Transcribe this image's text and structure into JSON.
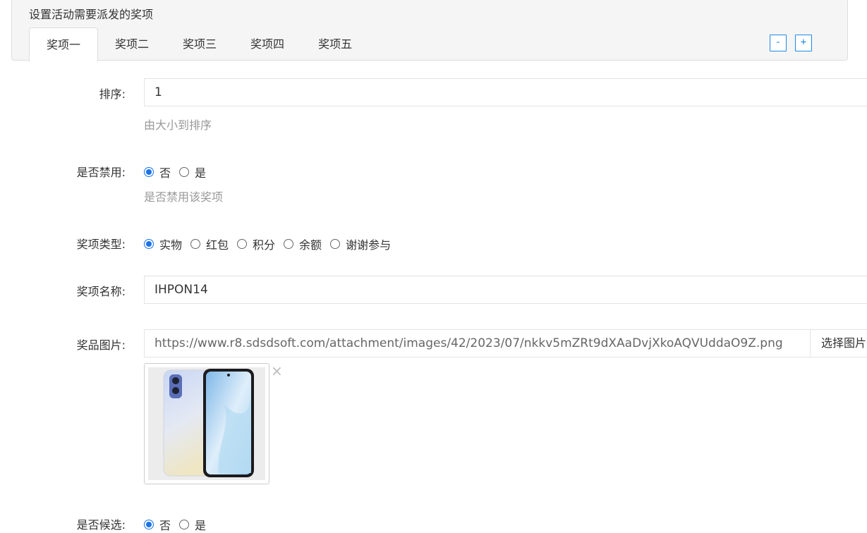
{
  "panel": {
    "title": "设置活动需要派发的奖项",
    "tabs": [
      {
        "label": "奖项一",
        "active": true
      },
      {
        "label": "奖项二",
        "active": false
      },
      {
        "label": "奖项三",
        "active": false
      },
      {
        "label": "奖项四",
        "active": false
      },
      {
        "label": "奖项五",
        "active": false
      }
    ],
    "minus_label": "-",
    "plus_label": "+"
  },
  "form": {
    "sort": {
      "label": "排序:",
      "value": "1",
      "help": "由大小到排序"
    },
    "disabled": {
      "label": "是否禁用:",
      "options": [
        {
          "label": "否",
          "checked": true
        },
        {
          "label": "是",
          "checked": false
        }
      ],
      "help": "是否禁用该奖项"
    },
    "prize_type": {
      "label": "奖项类型:",
      "options": [
        {
          "label": "实物",
          "checked": true
        },
        {
          "label": "红包",
          "checked": false
        },
        {
          "label": "积分",
          "checked": false
        },
        {
          "label": "余额",
          "checked": false
        },
        {
          "label": "谢谢参与",
          "checked": false
        }
      ]
    },
    "prize_name": {
      "label": "奖项名称:",
      "value": "IHPON14"
    },
    "prize_image": {
      "label": "奖品图片:",
      "url": "https://www.r8.sdsdsoft.com/attachment/images/42/2023/07/nkkv5mZRt9dXAaDvjXkoAQVUddaO9Z.png",
      "choose_label": "选择图片",
      "remove_symbol": "×"
    },
    "candidate": {
      "label": "是否候选:",
      "options": [
        {
          "label": "否",
          "checked": true
        },
        {
          "label": "是",
          "checked": false
        }
      ]
    }
  },
  "colors": {
    "accent": "#1a73e8",
    "help_text": "#999999",
    "border": "#e3e3e3"
  },
  "icons": {
    "thumbnail": "phone-image-icon",
    "remove": "close-icon"
  }
}
